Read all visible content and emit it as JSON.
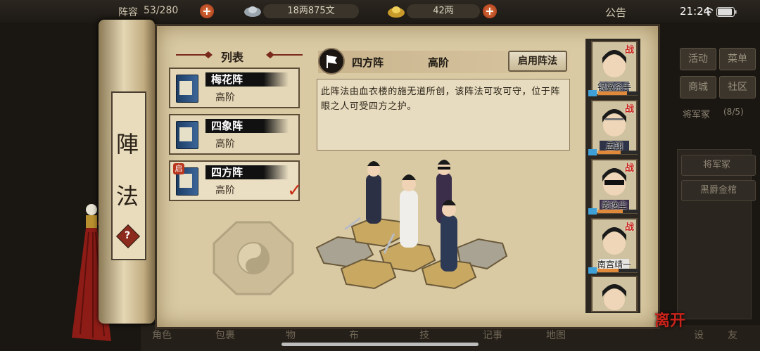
{
  "topbar": {
    "troops_label": "阵容",
    "troops_value": "53/280",
    "silver": "18两875文",
    "gold": "42两",
    "announcement": "公告",
    "time": "21:24"
  },
  "scroll_title": [
    "陣",
    "法"
  ],
  "list": {
    "header": "列表",
    "items": [
      {
        "name": "梅花阵",
        "tier": "高阶"
      },
      {
        "name": "四象阵",
        "tier": "高阶"
      },
      {
        "name": "四方阵",
        "tier": "高阶",
        "badge": "启"
      }
    ]
  },
  "detail": {
    "name": "四方阵",
    "tier": "高阶",
    "enable_button": "启用阵法",
    "description": "此阵法由血衣楼的施无道所创，该阵法可攻可守，位于阵眼之人可受四方之护。"
  },
  "heroes": [
    {
      "name": "银翼杀手",
      "status": "战"
    },
    {
      "name": "孟翔",
      "status": "战"
    },
    {
      "name": "姜逸尘",
      "status": "战"
    },
    {
      "name": "南宫靖一",
      "status": "战"
    },
    {
      "name": "",
      "status": ""
    }
  ],
  "right_menu": {
    "buttons": [
      "活动",
      "菜单",
      "商城",
      "社区"
    ],
    "general_house": "将军冢",
    "general_count": "(8/5)",
    "general_house_btn": "将军冢",
    "coffin_btn": "黑爵金棺"
  },
  "bottom_nav": [
    "角色",
    "包裹",
    "物",
    "布",
    "技",
    "记事",
    "地图",
    "设",
    "友"
  ],
  "leave_label": "离开",
  "colors": {
    "accent_red": "#c8231a",
    "parchment": "#d9caa4",
    "ink": "#1d1812"
  }
}
